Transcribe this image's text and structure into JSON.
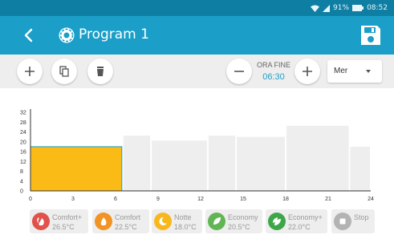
{
  "status": {
    "battery": "91%",
    "time": "08:52"
  },
  "appbar": {
    "title": "Program 1"
  },
  "toolbar": {
    "end_time_label": "ORA FINE",
    "end_time_value": "06:30",
    "day_select": {
      "value": "Mer"
    }
  },
  "chart_data": {
    "type": "bar",
    "title": "",
    "xlabel": "",
    "ylabel": "",
    "xlim": [
      0,
      24
    ],
    "ylim": [
      0,
      32
    ],
    "x_ticks": [
      0,
      3,
      6,
      9,
      12,
      15,
      18,
      21,
      24
    ],
    "y_ticks": [
      0,
      4,
      8,
      12,
      16,
      20,
      24,
      28,
      32
    ],
    "segments": [
      {
        "start": 0,
        "end": 6.5,
        "value": 18.0,
        "mode": "Notte",
        "selected": true
      },
      {
        "start": 6.5,
        "end": 8.5,
        "value": 22.5,
        "mode": "Comfort"
      },
      {
        "start": 8.5,
        "end": 12.5,
        "value": 20.5,
        "mode": "Economy"
      },
      {
        "start": 12.5,
        "end": 14.5,
        "value": 22.5,
        "mode": "Comfort"
      },
      {
        "start": 14.5,
        "end": 18,
        "value": 22.0,
        "mode": "Economy+"
      },
      {
        "start": 18,
        "end": 22.5,
        "value": 26.5,
        "mode": "Comfort+"
      },
      {
        "start": 22.5,
        "end": 24,
        "value": 18.0,
        "mode": "Notte"
      }
    ],
    "colors": {
      "selected_fill": "#fbbb17",
      "selected_stroke": "#1b9fc8",
      "default_fill": "#eeeeee"
    },
    "grid": false
  },
  "legend": [
    {
      "name": "Comfort+",
      "temp": "26.5°C",
      "color": "#e0524a",
      "icon": "double-flame-icon"
    },
    {
      "name": "Comfort",
      "temp": "22.5°C",
      "color": "#f29425",
      "icon": "flame-icon"
    },
    {
      "name": "Notte",
      "temp": "18.0°C",
      "color": "#f8b81d",
      "icon": "moon-icon"
    },
    {
      "name": "Economy",
      "temp": "20.5°C",
      "color": "#62b553",
      "icon": "leaf-icon"
    },
    {
      "name": "Economy+",
      "temp": "22.0°C",
      "color": "#3da649",
      "icon": "double-leaf-icon"
    },
    {
      "name": "Stop",
      "temp": "",
      "color": "#b3b3b3",
      "icon": "stop-icon"
    }
  ]
}
